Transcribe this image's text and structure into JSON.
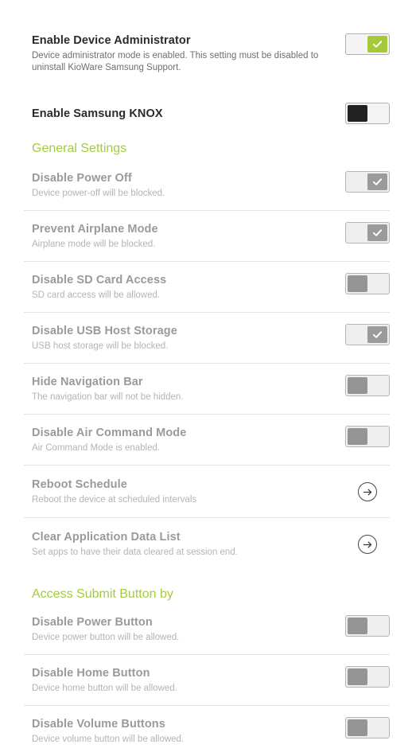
{
  "colors": {
    "accent_green": "#a6ca3f",
    "toggle_on_green": "#a4c93c",
    "toggle_off_dark": "#222222",
    "toggle_dim_knob": "#9b9b9b",
    "title": "#2b2b2b",
    "title_disabled": "#9a9a9a",
    "subtitle": "#6f6f6f",
    "subtitle_disabled": "#b4b4b4",
    "separator": "#e4e4e4"
  },
  "settings": {
    "device_administrator": {
      "title": "Enable Device Administrator",
      "subtitle": "Device administrator mode is enabled. This setting must be disabled to uninstall KioWare Samsung Support.",
      "toggle_state": "on",
      "toggle_style": "accent",
      "enabled": true
    },
    "samsung_knox": {
      "title": "Enable Samsung KNOX",
      "subtitle": "",
      "toggle_state": "off",
      "toggle_style": "dark",
      "enabled": true
    }
  },
  "sections": [
    {
      "header": "General Settings",
      "rows": [
        {
          "title": "Disable Power Off",
          "subtitle": "Device power-off will be blocked.",
          "control": "toggle",
          "toggle_state": "on",
          "toggle_style": "dim",
          "enabled": false
        },
        {
          "title": "Prevent Airplane Mode",
          "subtitle": "Airplane mode will be blocked.",
          "control": "toggle",
          "toggle_state": "on",
          "toggle_style": "dim",
          "enabled": false
        },
        {
          "title": "Disable SD Card Access",
          "subtitle": "SD card access will be allowed.",
          "control": "toggle",
          "toggle_state": "off",
          "toggle_style": "dim",
          "enabled": false
        },
        {
          "title": "Disable USB Host Storage",
          "subtitle": "USB host storage will be blocked.",
          "control": "toggle",
          "toggle_state": "on",
          "toggle_style": "dim",
          "enabled": false
        },
        {
          "title": "Hide Navigation Bar",
          "subtitle": "The navigation bar will not be hidden.",
          "control": "toggle",
          "toggle_state": "off",
          "toggle_style": "dim",
          "enabled": false
        },
        {
          "title": "Disable Air Command Mode",
          "subtitle": "Air Command Mode is enabled.",
          "control": "toggle",
          "toggle_state": "off",
          "toggle_style": "dim",
          "enabled": false
        },
        {
          "title": "Reboot Schedule",
          "subtitle": "Reboot the device at scheduled intervals",
          "control": "arrow",
          "icon": "arrow-right-circle-icon",
          "enabled": false
        },
        {
          "title": "Clear Application Data List",
          "subtitle": "Set apps to have their data cleared at session end.",
          "control": "arrow",
          "icon": "arrow-right-circle-icon",
          "enabled": false
        }
      ]
    },
    {
      "header": "Access Submit Button by",
      "rows": [
        {
          "title": "Disable Power Button",
          "subtitle": "Device power button will be allowed.",
          "control": "toggle",
          "toggle_state": "off",
          "toggle_style": "dim",
          "enabled": false
        },
        {
          "title": "Disable Home Button",
          "subtitle": "Device home button will be allowed.",
          "control": "toggle",
          "toggle_state": "off",
          "toggle_style": "dim",
          "enabled": false
        },
        {
          "title": "Disable Volume Buttons",
          "subtitle": "Device volume button will be allowed.",
          "control": "toggle",
          "toggle_state": "off",
          "toggle_style": "dim",
          "enabled": false
        }
      ]
    }
  ]
}
